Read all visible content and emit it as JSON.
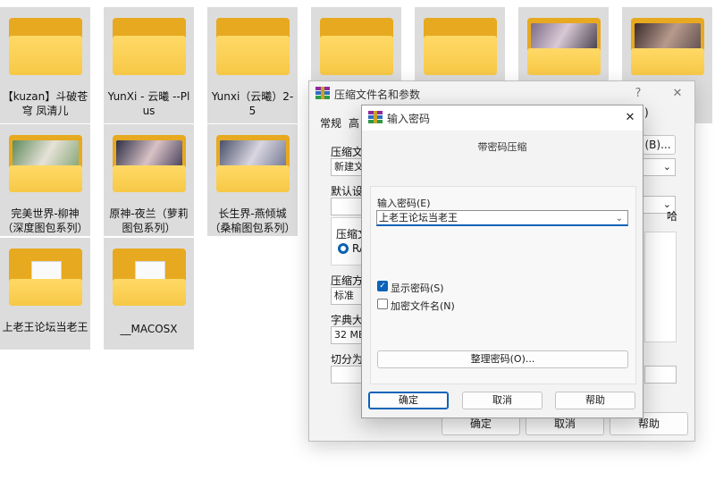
{
  "files": [
    {
      "name": "【kuzan】斗破苍穹 凤清儿"
    },
    {
      "name": "YunXi - 云曦 --Plus"
    },
    {
      "name": "Yunxi（云曦）2-5"
    },
    {
      "name": ""
    },
    {
      "name": ""
    },
    {
      "name": ""
    },
    {
      "name": ""
    },
    {
      "name": "完美世界-柳神（深度图包系列）"
    },
    {
      "name": "原神-夜兰（萝莉图包系列）"
    },
    {
      "name": "长生界-燕倾城（桑榆图包系列）"
    },
    {
      "name": "上老王论坛当老王"
    },
    {
      "name": "__MACOSX"
    }
  ],
  "archive_dialog": {
    "title": "压缩文件名和参数",
    "help_icon": "?",
    "close_icon": "✕",
    "tab_general": "常规",
    "tab_advanced": "高",
    "archive_name_label": "压缩文",
    "archive_name_value": "新建文",
    "browse_button": "(B)...",
    "profile_label": "默认设",
    "format_label": "压缩文",
    "format_option": "RA",
    "method_label": "压缩方",
    "method_value": "标准",
    "dict_label": "字典大",
    "dict_value": "32 MB",
    "split_label": "切分为",
    "right_fragment_1": ")",
    "right_fragment_2": "哈",
    "ok_button": "确定",
    "cancel_button": "取消",
    "help_button": "帮助"
  },
  "password_dialog": {
    "title": "输入密码",
    "heading": "带密码压缩",
    "enter_password_label": "输入密码(E)",
    "password_value": "上老王论坛当老王",
    "show_password_label": "显示密码(S)",
    "show_password_checked": true,
    "encrypt_names_label": "加密文件名(N)",
    "encrypt_names_checked": false,
    "organize_button": "整理密码(O)...",
    "ok_button": "确定",
    "cancel_button": "取消",
    "help_button": "帮助",
    "close_icon": "✕"
  }
}
